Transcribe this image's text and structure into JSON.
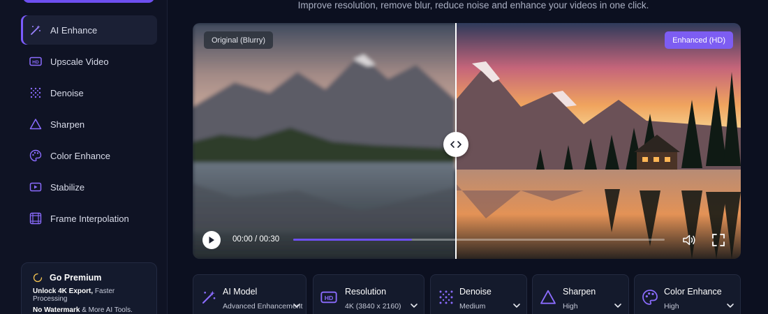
{
  "sidebar": {
    "items": [
      {
        "label": "AI Enhance",
        "icon": "magic-wand-icon",
        "active": true
      },
      {
        "label": "Upscale Video",
        "icon": "hd-icon"
      },
      {
        "label": "Denoise",
        "icon": "dots-grid-icon"
      },
      {
        "label": "Sharpen",
        "icon": "triangle-icon"
      },
      {
        "label": "Color Enhance",
        "icon": "palette-icon"
      },
      {
        "label": "Stabilize",
        "icon": "video-stabilize-icon"
      },
      {
        "label": "Frame Interpolation",
        "icon": "frames-icon"
      }
    ],
    "premium": {
      "title": "Go Premium",
      "line1_bold": "Unlock 4K Export,",
      "line1_rest": "Faster Processing",
      "line2_bold": "No Watermark",
      "line2_rest": "& More AI Tools."
    }
  },
  "main": {
    "subtitle": "Improve resolution, remove blur, reduce noise and enhance your videos in one click.",
    "player": {
      "label_original": "Original (Blurry)",
      "label_enhanced": "Enhanced (HD)",
      "time": "00:00 / 00:30",
      "progress": 0.32
    },
    "settings": [
      {
        "title": "AI Model",
        "value": "Advanced Enhancement",
        "icon": "magic-wand-icon"
      },
      {
        "title": "Resolution",
        "value": "4K (3840 x 2160)",
        "icon": "hd-icon"
      },
      {
        "title": "Denoise",
        "value": "Medium",
        "icon": "dots-grid-icon"
      },
      {
        "title": "Sharpen",
        "value": "High",
        "icon": "triangle-icon"
      },
      {
        "title": "Color Enhance",
        "value": "High",
        "icon": "palette-icon"
      }
    ]
  },
  "colors": {
    "accent": "#7c5cff",
    "background": "#0c1020"
  }
}
